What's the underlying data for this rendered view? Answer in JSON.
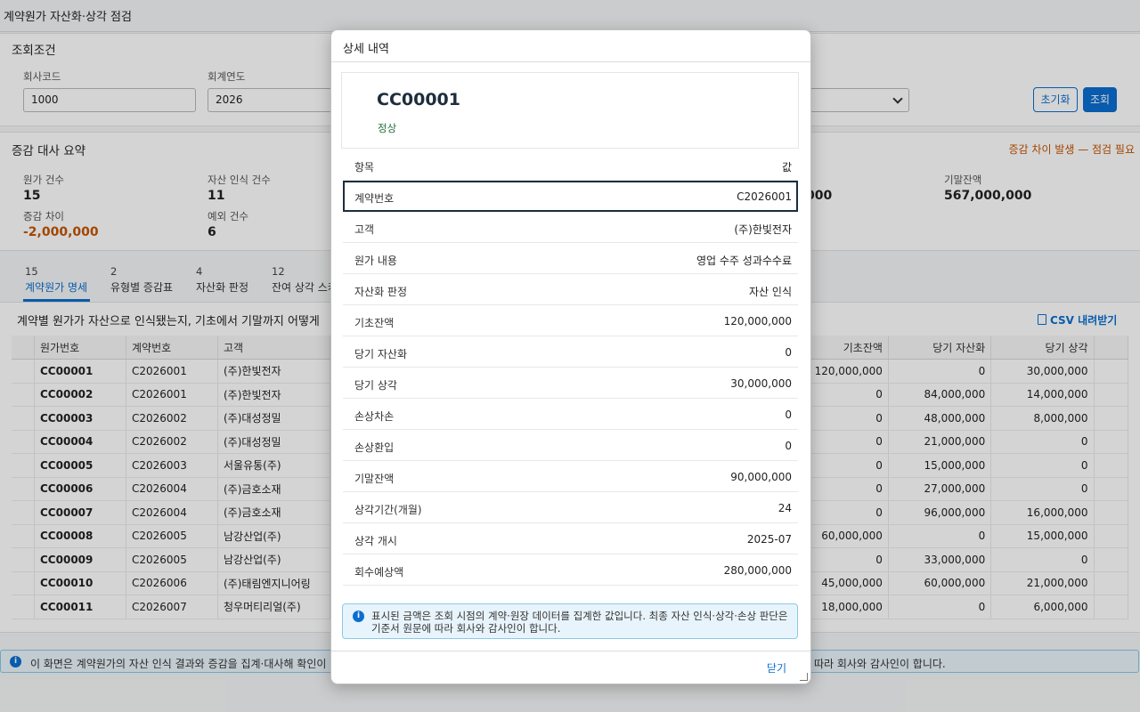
{
  "app_title": "계약원가 자산화·상각 점검",
  "filter": {
    "title": "조회조건",
    "company_label": "회사코드",
    "company_value": "1000",
    "year_label": "회계연도",
    "year_value": "2026",
    "reset_label": "초기화",
    "search_label": "조회"
  },
  "summary": {
    "title": "증감 대사 요약",
    "status_text": "증감 차이 발생 — 점검 필요",
    "kpis": [
      {
        "label": "원가 건수",
        "value": "15"
      },
      {
        "label": "자산 인식 건수",
        "value": "11"
      },
      {
        "label": "증감 차이",
        "value": "-2,000,000"
      },
      {
        "label": "예외 건수",
        "value": "6"
      },
      {
        "label": "기말잔액",
        "value": "567,000,000"
      }
    ],
    "partial_value": "000"
  },
  "tabs": [
    {
      "count": "15",
      "label": "계약원가 명세"
    },
    {
      "count": "2",
      "label": "유형별 증감표"
    },
    {
      "count": "4",
      "label": "자산화 판정"
    },
    {
      "count": "12",
      "label": "잔여 상각 스케"
    }
  ],
  "table": {
    "description": "계약별 원가가 자산으로 인식됐는지, 기초에서 기말까지 어떻게",
    "csv_label": "CSV 내려받기",
    "left_headers": [
      "원가번호",
      "계약번호",
      "고객"
    ],
    "right_headers": [
      "기초잔액",
      "당기 자산화",
      "당기 상각"
    ],
    "rows": [
      {
        "cost": "CC00001",
        "contract": "C2026001",
        "customer": "(주)한빛전자",
        "open": "120,000,000",
        "cap": "0",
        "amort": "30,000,000"
      },
      {
        "cost": "CC00002",
        "contract": "C2026001",
        "customer": "(주)한빛전자",
        "open": "0",
        "cap": "84,000,000",
        "amort": "14,000,000"
      },
      {
        "cost": "CC00003",
        "contract": "C2026002",
        "customer": "(주)대성정밀",
        "open": "0",
        "cap": "48,000,000",
        "amort": "8,000,000"
      },
      {
        "cost": "CC00004",
        "contract": "C2026002",
        "customer": "(주)대성정밀",
        "open": "0",
        "cap": "21,000,000",
        "amort": "0"
      },
      {
        "cost": "CC00005",
        "contract": "C2026003",
        "customer": "서울유통(주)",
        "open": "0",
        "cap": "15,000,000",
        "amort": "0"
      },
      {
        "cost": "CC00006",
        "contract": "C2026004",
        "customer": "(주)금호소재",
        "open": "0",
        "cap": "27,000,000",
        "amort": "0"
      },
      {
        "cost": "CC00007",
        "contract": "C2026004",
        "customer": "(주)금호소재",
        "open": "0",
        "cap": "96,000,000",
        "amort": "16,000,000"
      },
      {
        "cost": "CC00008",
        "contract": "C2026005",
        "customer": "남강산업(주)",
        "open": "60,000,000",
        "cap": "0",
        "amort": "15,000,000"
      },
      {
        "cost": "CC00009",
        "contract": "C2026005",
        "customer": "남강산업(주)",
        "open": "0",
        "cap": "33,000,000",
        "amort": "0"
      },
      {
        "cost": "CC00010",
        "contract": "C2026006",
        "customer": "(주)태림엔지니어링",
        "open": "45,000,000",
        "cap": "60,000,000",
        "amort": "21,000,000"
      },
      {
        "cost": "CC00011",
        "contract": "C2026007",
        "customer": "청우머티리얼(주)",
        "open": "18,000,000",
        "cap": "0",
        "amort": "6,000,000"
      }
    ]
  },
  "footer_info": {
    "left_text": "이 화면은 계약원가의 자산 인식 결과와 증감을 집계·대사해 확인이 필",
    "right_text": "따라 회사와 감사인이 합니다."
  },
  "dialog": {
    "title": "상세 내역",
    "object_title": "CC00001",
    "object_status": "정상",
    "header_key": "항목",
    "header_value": "값",
    "rows": [
      {
        "key": "계약번호",
        "value": "C2026001"
      },
      {
        "key": "고객",
        "value": "(주)한빛전자"
      },
      {
        "key": "원가 내용",
        "value": "영업 수주 성과수수료"
      },
      {
        "key": "자산화 판정",
        "value": "자산 인식"
      },
      {
        "key": "기초잔액",
        "value": "120,000,000"
      },
      {
        "key": "당기 자산화",
        "value": "0"
      },
      {
        "key": "당기 상각",
        "value": "30,000,000"
      },
      {
        "key": "손상차손",
        "value": "0"
      },
      {
        "key": "손상환입",
        "value": "0"
      },
      {
        "key": "기말잔액",
        "value": "90,000,000"
      },
      {
        "key": "상각기간(개월)",
        "value": "24"
      },
      {
        "key": "상각 개시",
        "value": "2025-07"
      },
      {
        "key": "회수예상액",
        "value": "280,000,000"
      }
    ],
    "info_text": "표시된 금액은 조회 시점의 계약·원장 데이터를 집계한 값입니다. 최종 자산 인식·상각·손상 판단은 기준서 원문에 따라 회사와 감사인이 합니다.",
    "close_label": "닫기"
  },
  "colors": {
    "accent": "#0a6ed1",
    "warning": "#c35500",
    "positive": "#256f3a"
  }
}
